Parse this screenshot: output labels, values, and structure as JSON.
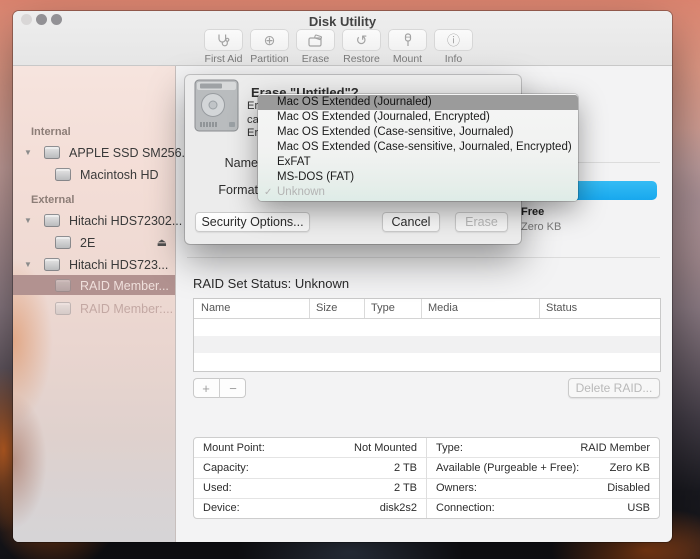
{
  "window": {
    "title": "Disk Utility"
  },
  "toolbar": {
    "items": [
      {
        "label": "First Aid",
        "icon": "stethoscope-icon"
      },
      {
        "label": "Partition",
        "icon": "partition-icon"
      },
      {
        "label": "Erase",
        "icon": "erase-disk-icon"
      },
      {
        "label": "Restore",
        "icon": "restore-arrow-icon"
      },
      {
        "label": "Mount",
        "icon": "mount-plug-icon"
      },
      {
        "label": "Info",
        "icon": "info-circle-icon"
      }
    ]
  },
  "sidebar": {
    "sections": [
      {
        "label": "Internal"
      },
      {
        "label": "External"
      }
    ],
    "rows": [
      {
        "label": "APPLE SSD SM256..."
      },
      {
        "label": "Macintosh HD"
      },
      {
        "label": "Hitachi HDS72302..."
      },
      {
        "label": "2E"
      },
      {
        "label": "Hitachi HDS723..."
      },
      {
        "label": "RAID Member..."
      },
      {
        "label": "RAID Member:..."
      }
    ]
  },
  "dialog": {
    "title": "Erase \"Untitled\"?",
    "body_line1": "Erasing \"Untitled\" will delete all data stored on it, and",
    "body_line2": "cannot be undone. Provide a name and format, and click",
    "body_line3": "Erase to proceed.",
    "name_label": "Name",
    "format_label": "Format",
    "security_button": "Security Options...",
    "cancel_button": "Cancel",
    "erase_button": "Erase"
  },
  "format_menu": {
    "items": [
      {
        "label": "Mac OS Extended (Journaled)",
        "highlighted": true
      },
      {
        "label": "Mac OS Extended (Journaled, Encrypted)"
      },
      {
        "label": "Mac OS Extended (Case-sensitive, Journaled)"
      },
      {
        "label": "Mac OS Extended (Case-sensitive, Journaled, Encrypted)"
      },
      {
        "label": "ExFAT"
      },
      {
        "label": "MS-DOS (FAT)"
      },
      {
        "label": "Unknown",
        "checked": true,
        "disabled": true
      }
    ]
  },
  "main": {
    "free_label": "Free",
    "free_value": "Zero KB",
    "raid_status": "RAID Set Status: Unknown",
    "table_headers": [
      "Name",
      "Size",
      "Type",
      "Media",
      "Status"
    ],
    "add_label": "+",
    "remove_label": "−",
    "delete_raid_label": "Delete RAID...",
    "info_left": [
      {
        "label": "Mount Point:",
        "value": "Not Mounted"
      },
      {
        "label": "Capacity:",
        "value": "2 TB"
      },
      {
        "label": "Used:",
        "value": "2 TB"
      },
      {
        "label": "Device:",
        "value": "disk2s2"
      }
    ],
    "info_right": [
      {
        "label": "Type:",
        "value": "RAID Member"
      },
      {
        "label": "Available (Purgeable + Free):",
        "value": "Zero KB"
      },
      {
        "label": "Owners:",
        "value": "Disabled"
      },
      {
        "label": "Connection:",
        "value": "USB"
      }
    ]
  },
  "icons": {
    "eject": "⏏",
    "check": "✓",
    "disclosure": "▼",
    "restore": "↺",
    "info": "ⓘ",
    "partition": "⊕"
  },
  "colors": {
    "accent_blue": "#1fb0f2",
    "menu_highlight": "#9b9b9b",
    "sidebar_selection": "#b29290"
  }
}
